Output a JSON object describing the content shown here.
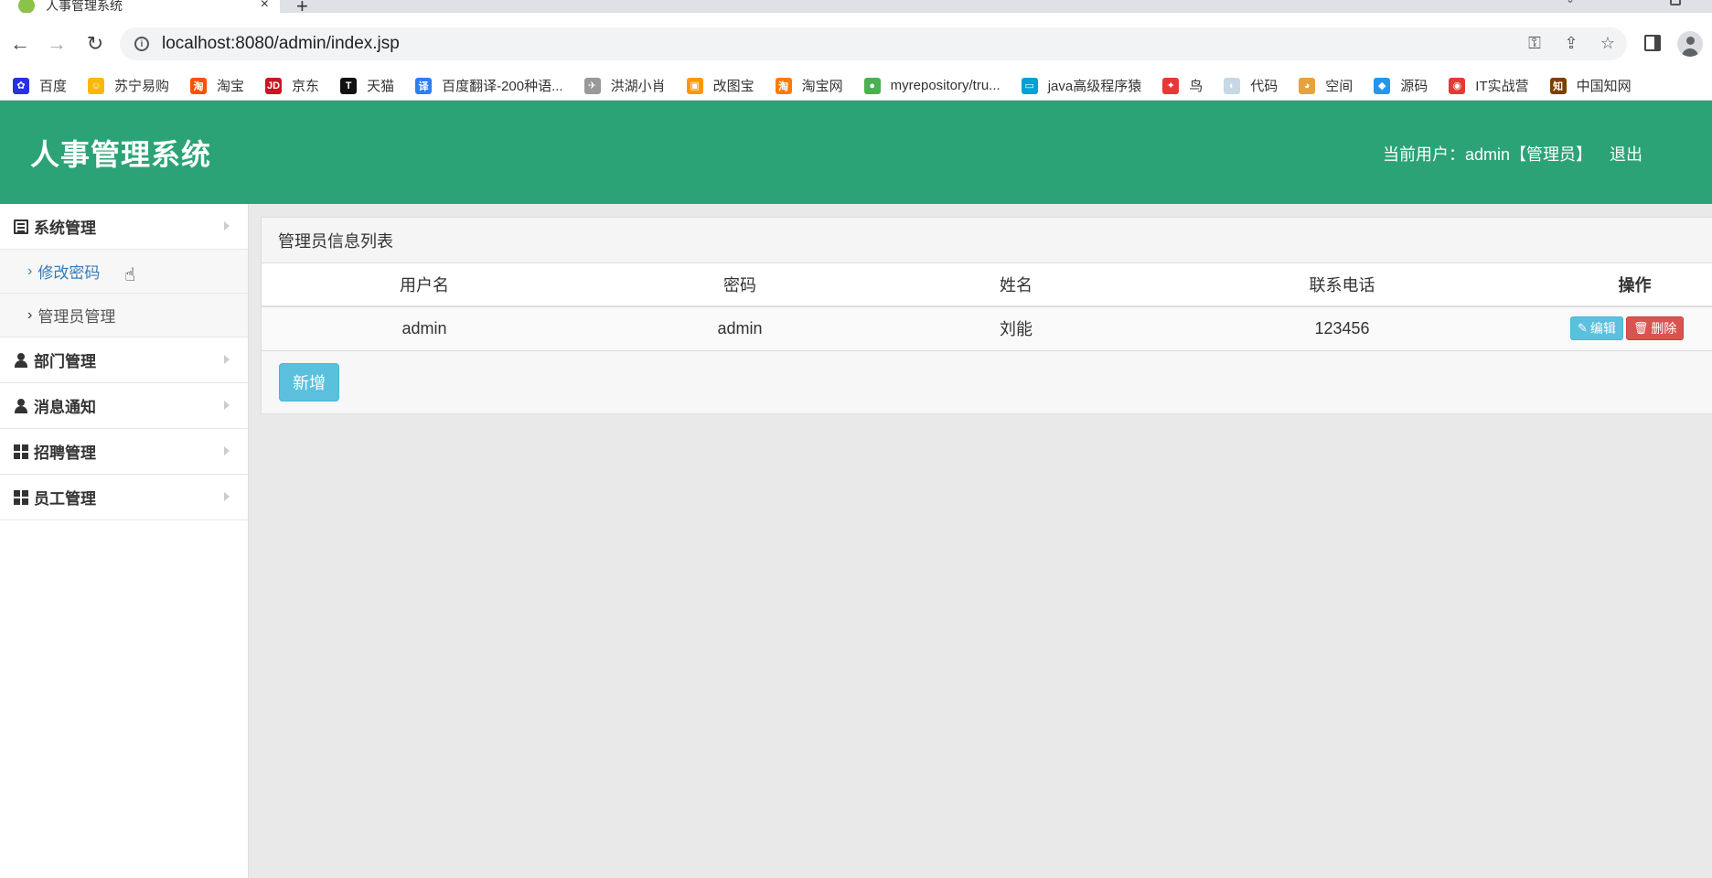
{
  "browser": {
    "tab_title": "人事管理系统",
    "tab_close": "×",
    "new_tab": "+",
    "url": "localhost:8080/admin/index.jsp"
  },
  "bookmarks": [
    {
      "label": "百度",
      "icon": "baidu-paw-icon",
      "color": "#2932e1",
      "glyph": "✿"
    },
    {
      "label": "苏宁易购",
      "icon": "suning-icon",
      "color": "#f9b707",
      "glyph": "☺"
    },
    {
      "label": "淘宝",
      "icon": "taobao-icon",
      "color": "#ff5000",
      "glyph": "淘"
    },
    {
      "label": "京东",
      "icon": "jd-icon",
      "color": "#c91623",
      "glyph": "JD"
    },
    {
      "label": "天猫",
      "icon": "tmall-icon",
      "color": "#111111",
      "glyph": "T"
    },
    {
      "label": "百度翻译-200种语...",
      "icon": "translate-icon",
      "color": "#2f7df6",
      "glyph": "译"
    },
    {
      "label": "洪湖小肖",
      "icon": "bird-icon",
      "color": "#999999",
      "glyph": "✈"
    },
    {
      "label": "改图宝",
      "icon": "gaitubao-icon",
      "color": "#ff9800",
      "glyph": "▣"
    },
    {
      "label": "淘宝网",
      "icon": "taobao-icon",
      "color": "#ff7a00",
      "glyph": "淘"
    },
    {
      "label": "myrepository/tru...",
      "icon": "chrome-icon",
      "color": "#4caf50",
      "glyph": "●"
    },
    {
      "label": "java高级程序猿",
      "icon": "bilibili-icon",
      "color": "#00a1d6",
      "glyph": "▭"
    },
    {
      "label": "鸟",
      "icon": "bird-icon",
      "color": "#e53935",
      "glyph": "✦"
    },
    {
      "label": "代码",
      "icon": "code-icon",
      "color": "#c5d8e8",
      "glyph": "◐"
    },
    {
      "label": "空间",
      "icon": "qzone-icon",
      "color": "#e6a23c",
      "glyph": "◕"
    },
    {
      "label": "源码",
      "icon": "docker-icon",
      "color": "#2496ed",
      "glyph": "◆"
    },
    {
      "label": "IT实战营",
      "icon": "chrome-icon",
      "color": "#e53935",
      "glyph": "◉"
    },
    {
      "label": "中国知网",
      "icon": "cnki-icon",
      "color": "#7b3f00",
      "glyph": "知"
    }
  ],
  "header": {
    "title": "人事管理系统",
    "current_user": "当前用户：admin【管理员】",
    "logout": "退出"
  },
  "sidebar": {
    "groups": [
      {
        "label": "系统管理",
        "icon": "list-icon"
      },
      {
        "label": "部门管理",
        "icon": "user-icon"
      },
      {
        "label": "消息通知",
        "icon": "user-icon"
      },
      {
        "label": "招聘管理",
        "icon": "grid-icon"
      },
      {
        "label": "员工管理",
        "icon": "grid-icon"
      }
    ],
    "sub_items": [
      {
        "label": "修改密码",
        "active": true
      },
      {
        "label": "管理员管理",
        "active": false
      }
    ]
  },
  "panel": {
    "title": "管理员信息列表",
    "columns": [
      "用户名",
      "密码",
      "姓名",
      "联系电话",
      "操作"
    ],
    "rows": [
      {
        "username": "admin",
        "password": "admin",
        "name": "刘能",
        "phone": "123456"
      }
    ],
    "edit_label": "编辑",
    "delete_label": "删除",
    "add_label": "新增"
  },
  "colors": {
    "header_bg": "#2ba377",
    "info_button": "#5bc0de",
    "danger_button": "#d9534f",
    "link_active": "#337ab7"
  }
}
